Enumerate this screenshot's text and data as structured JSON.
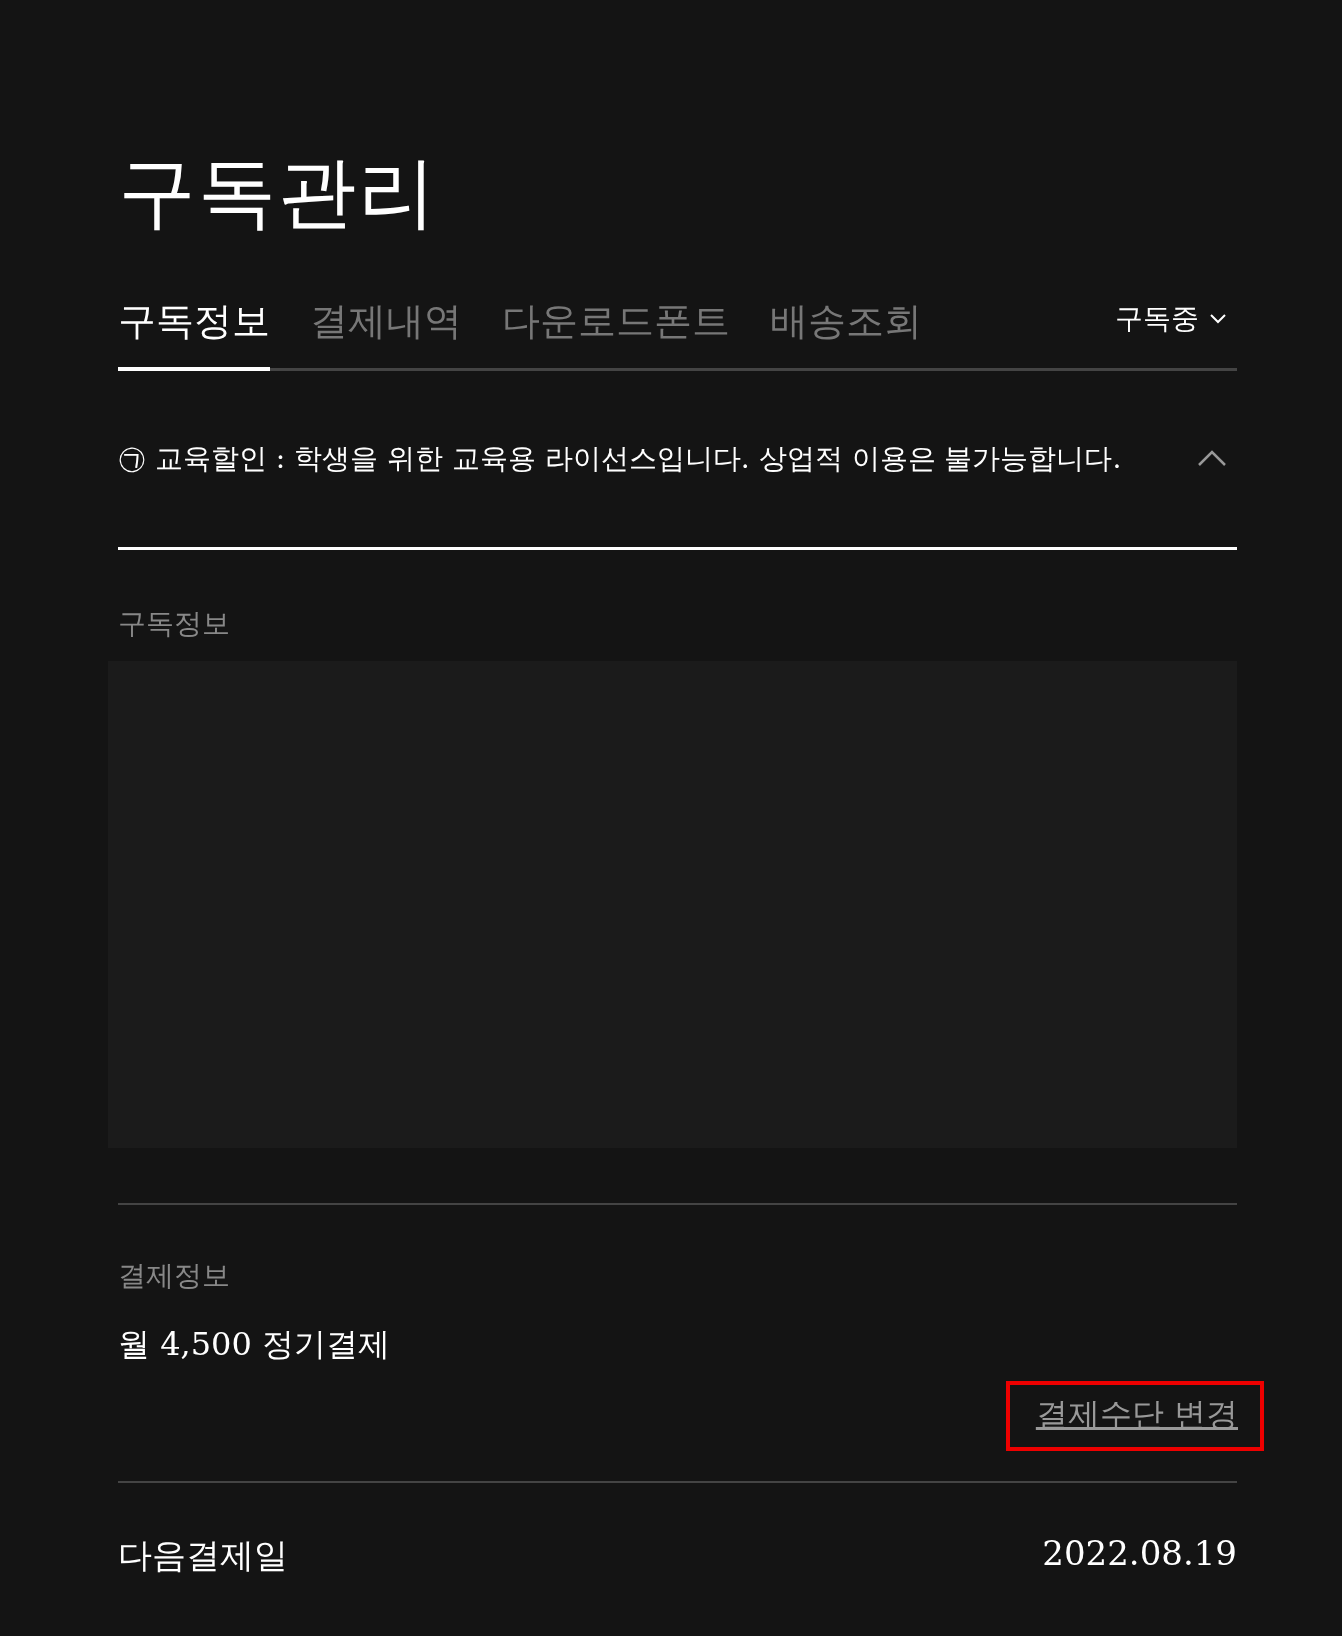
{
  "page_title": "구독관리",
  "tabs": [
    {
      "label": "구독정보",
      "selected": true
    },
    {
      "label": "결제내역",
      "selected": false
    },
    {
      "label": "다운로드폰트",
      "selected": false
    },
    {
      "label": "배송조회",
      "selected": false
    }
  ],
  "status_dropdown": {
    "value": "구독중"
  },
  "notice": {
    "text": "㉠ 교육할인 : 학생을 위한 교육용 라이선스입니다. 상업적 이용은 불가능합니다.",
    "expanded": true
  },
  "subscription_info": {
    "label": "구독정보"
  },
  "payment_info": {
    "label": "결제정보",
    "plan": "월 4,500 정기결제",
    "change_link": {
      "label": "결제수단 변경",
      "highlighted": true
    }
  },
  "next_payment": {
    "label": "다음결제일",
    "date": "2022.08.19"
  }
}
